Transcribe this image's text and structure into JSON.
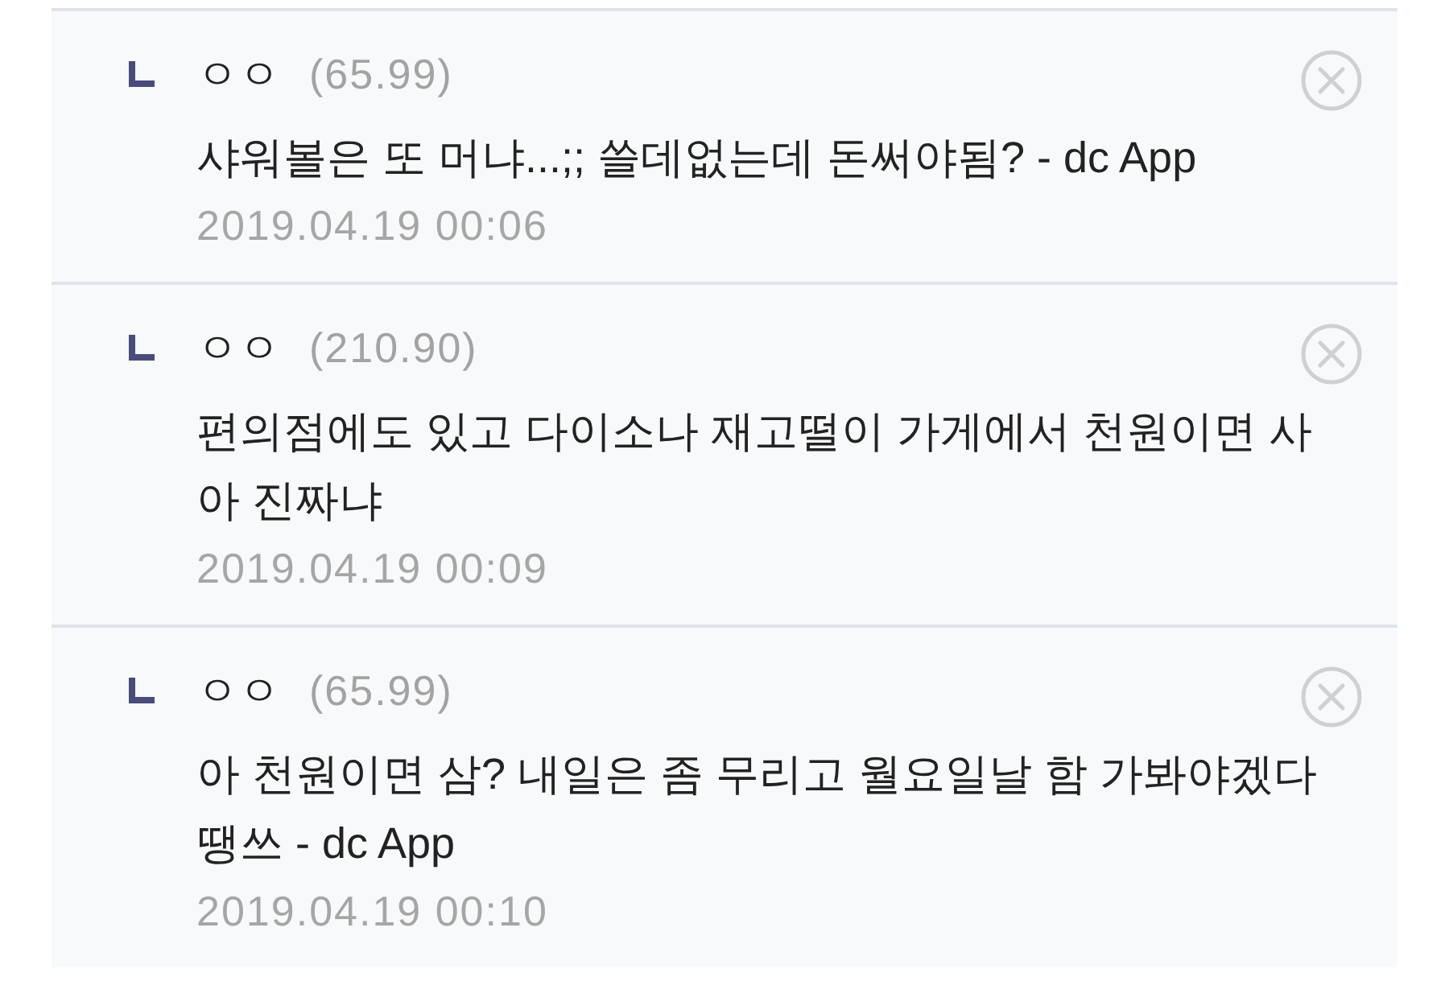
{
  "comments": [
    {
      "nickname": "ㅇㅇ",
      "ip": "(65.99)",
      "text": "샤워볼은 또 머냐...;; 쓸데없는데 돈써야됨? - dc App",
      "date": "2019.04.19 00:06"
    },
    {
      "nickname": "ㅇㅇ",
      "ip": "(210.90)",
      "text": "편의점에도 있고 다이소나 재고떨이 가게에서 천원이면 사 아 진짜냐",
      "date": "2019.04.19 00:09"
    },
    {
      "nickname": "ㅇㅇ",
      "ip": "(65.99)",
      "text": "아 천원이면 삼? 내일은 좀 무리고 월요일날 함 가봐야겠다 땡쓰 - dc App",
      "date": "2019.04.19 00:10"
    }
  ]
}
